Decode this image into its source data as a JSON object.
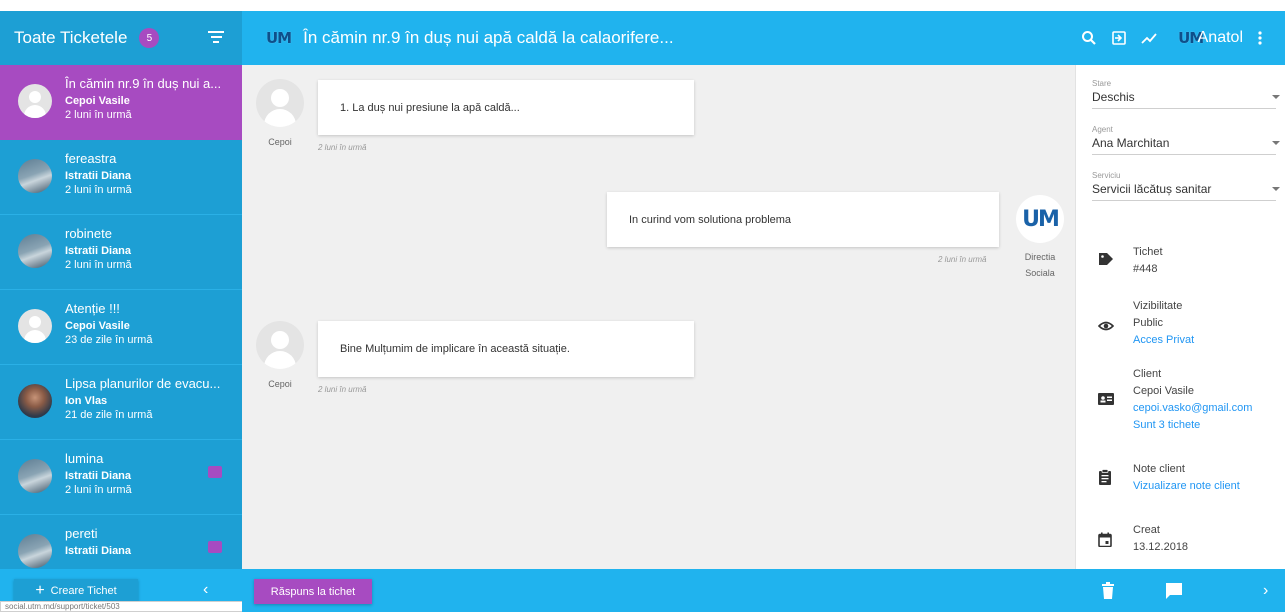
{
  "sidebar": {
    "title": "Toate Ticketele",
    "count": "5",
    "tickets": [
      {
        "title": "În cămin nr.9 în duș nui a...",
        "user": "Cepoi Vasile",
        "time": "2 luni în urmă",
        "avatar": "default",
        "active": true
      },
      {
        "title": "fereastra",
        "user": "Istratii Diana",
        "time": "2 luni în urmă",
        "avatar": "photo"
      },
      {
        "title": "robinete",
        "user": "Istratii Diana",
        "time": "2 luni în urmă",
        "avatar": "photo"
      },
      {
        "title": "Atenție !!!",
        "user": "Cepoi Vasile",
        "time": "23 de zile în urmă",
        "avatar": "default"
      },
      {
        "title": "Lipsa planurilor de evacu...",
        "user": "Ion Vlas",
        "time": "21 de zile în urmă",
        "avatar": "photo2"
      },
      {
        "title": "lumina",
        "user": "Istratii Diana",
        "time": "2 luni în urmă",
        "avatar": "photo",
        "unread": true
      },
      {
        "title": "pereti",
        "user": "Istratii Diana",
        "time": "",
        "avatar": "photo",
        "unread": true
      }
    ],
    "create_label": "Creare Tichet",
    "status_url": "social.utm.md/support/ticket/503"
  },
  "header": {
    "logo": "UM",
    "ticket_title": "În cămin nr.9 în duș nui apă caldă la calaorifere...",
    "user_logo": "UM",
    "user_name": "Anatol"
  },
  "chat": {
    "messages": [
      {
        "text": "1. La duș nui presiune la apă caldă...",
        "author": "Cepoi",
        "time": "2 luni în urmă"
      },
      {
        "text": "In curind vom solutiona problema",
        "author_line1": "Directia",
        "author_line2": "Sociala",
        "avatar_logo": "UM",
        "time": "2 luni în urmă"
      },
      {
        "text": "Bine Mulțumim de implicare în această situație.",
        "author": "Cepoi",
        "time": "2 luni în urmă"
      }
    ],
    "reply_label": "Răspuns la tichet"
  },
  "details": {
    "stare": {
      "label": "Stare",
      "value": "Deschis"
    },
    "agent": {
      "label": "Agent",
      "value": "Ana Marchitan"
    },
    "serviciu": {
      "label": "Serviciu",
      "value": "Servicii lăcătuș sanitar"
    },
    "tichet": {
      "label": "Tichet",
      "value": "#448"
    },
    "vizibilitate": {
      "label": "Vizibilitate",
      "value": "Public",
      "link": "Acces Privat"
    },
    "client": {
      "label": "Client",
      "name": "Cepoi Vasile",
      "email": "cepoi.vasko@gmail.com",
      "tickets": "Sunt 3 tichete"
    },
    "note": {
      "label": "Note client",
      "link": "Vizualizare note client"
    },
    "creat": {
      "label": "Creat",
      "value": "13.12.2018"
    }
  },
  "colors": {
    "sidebar": "#1d9fd4",
    "header": "#20b3ee",
    "accent": "#a74bc1",
    "link": "#2196f3"
  }
}
